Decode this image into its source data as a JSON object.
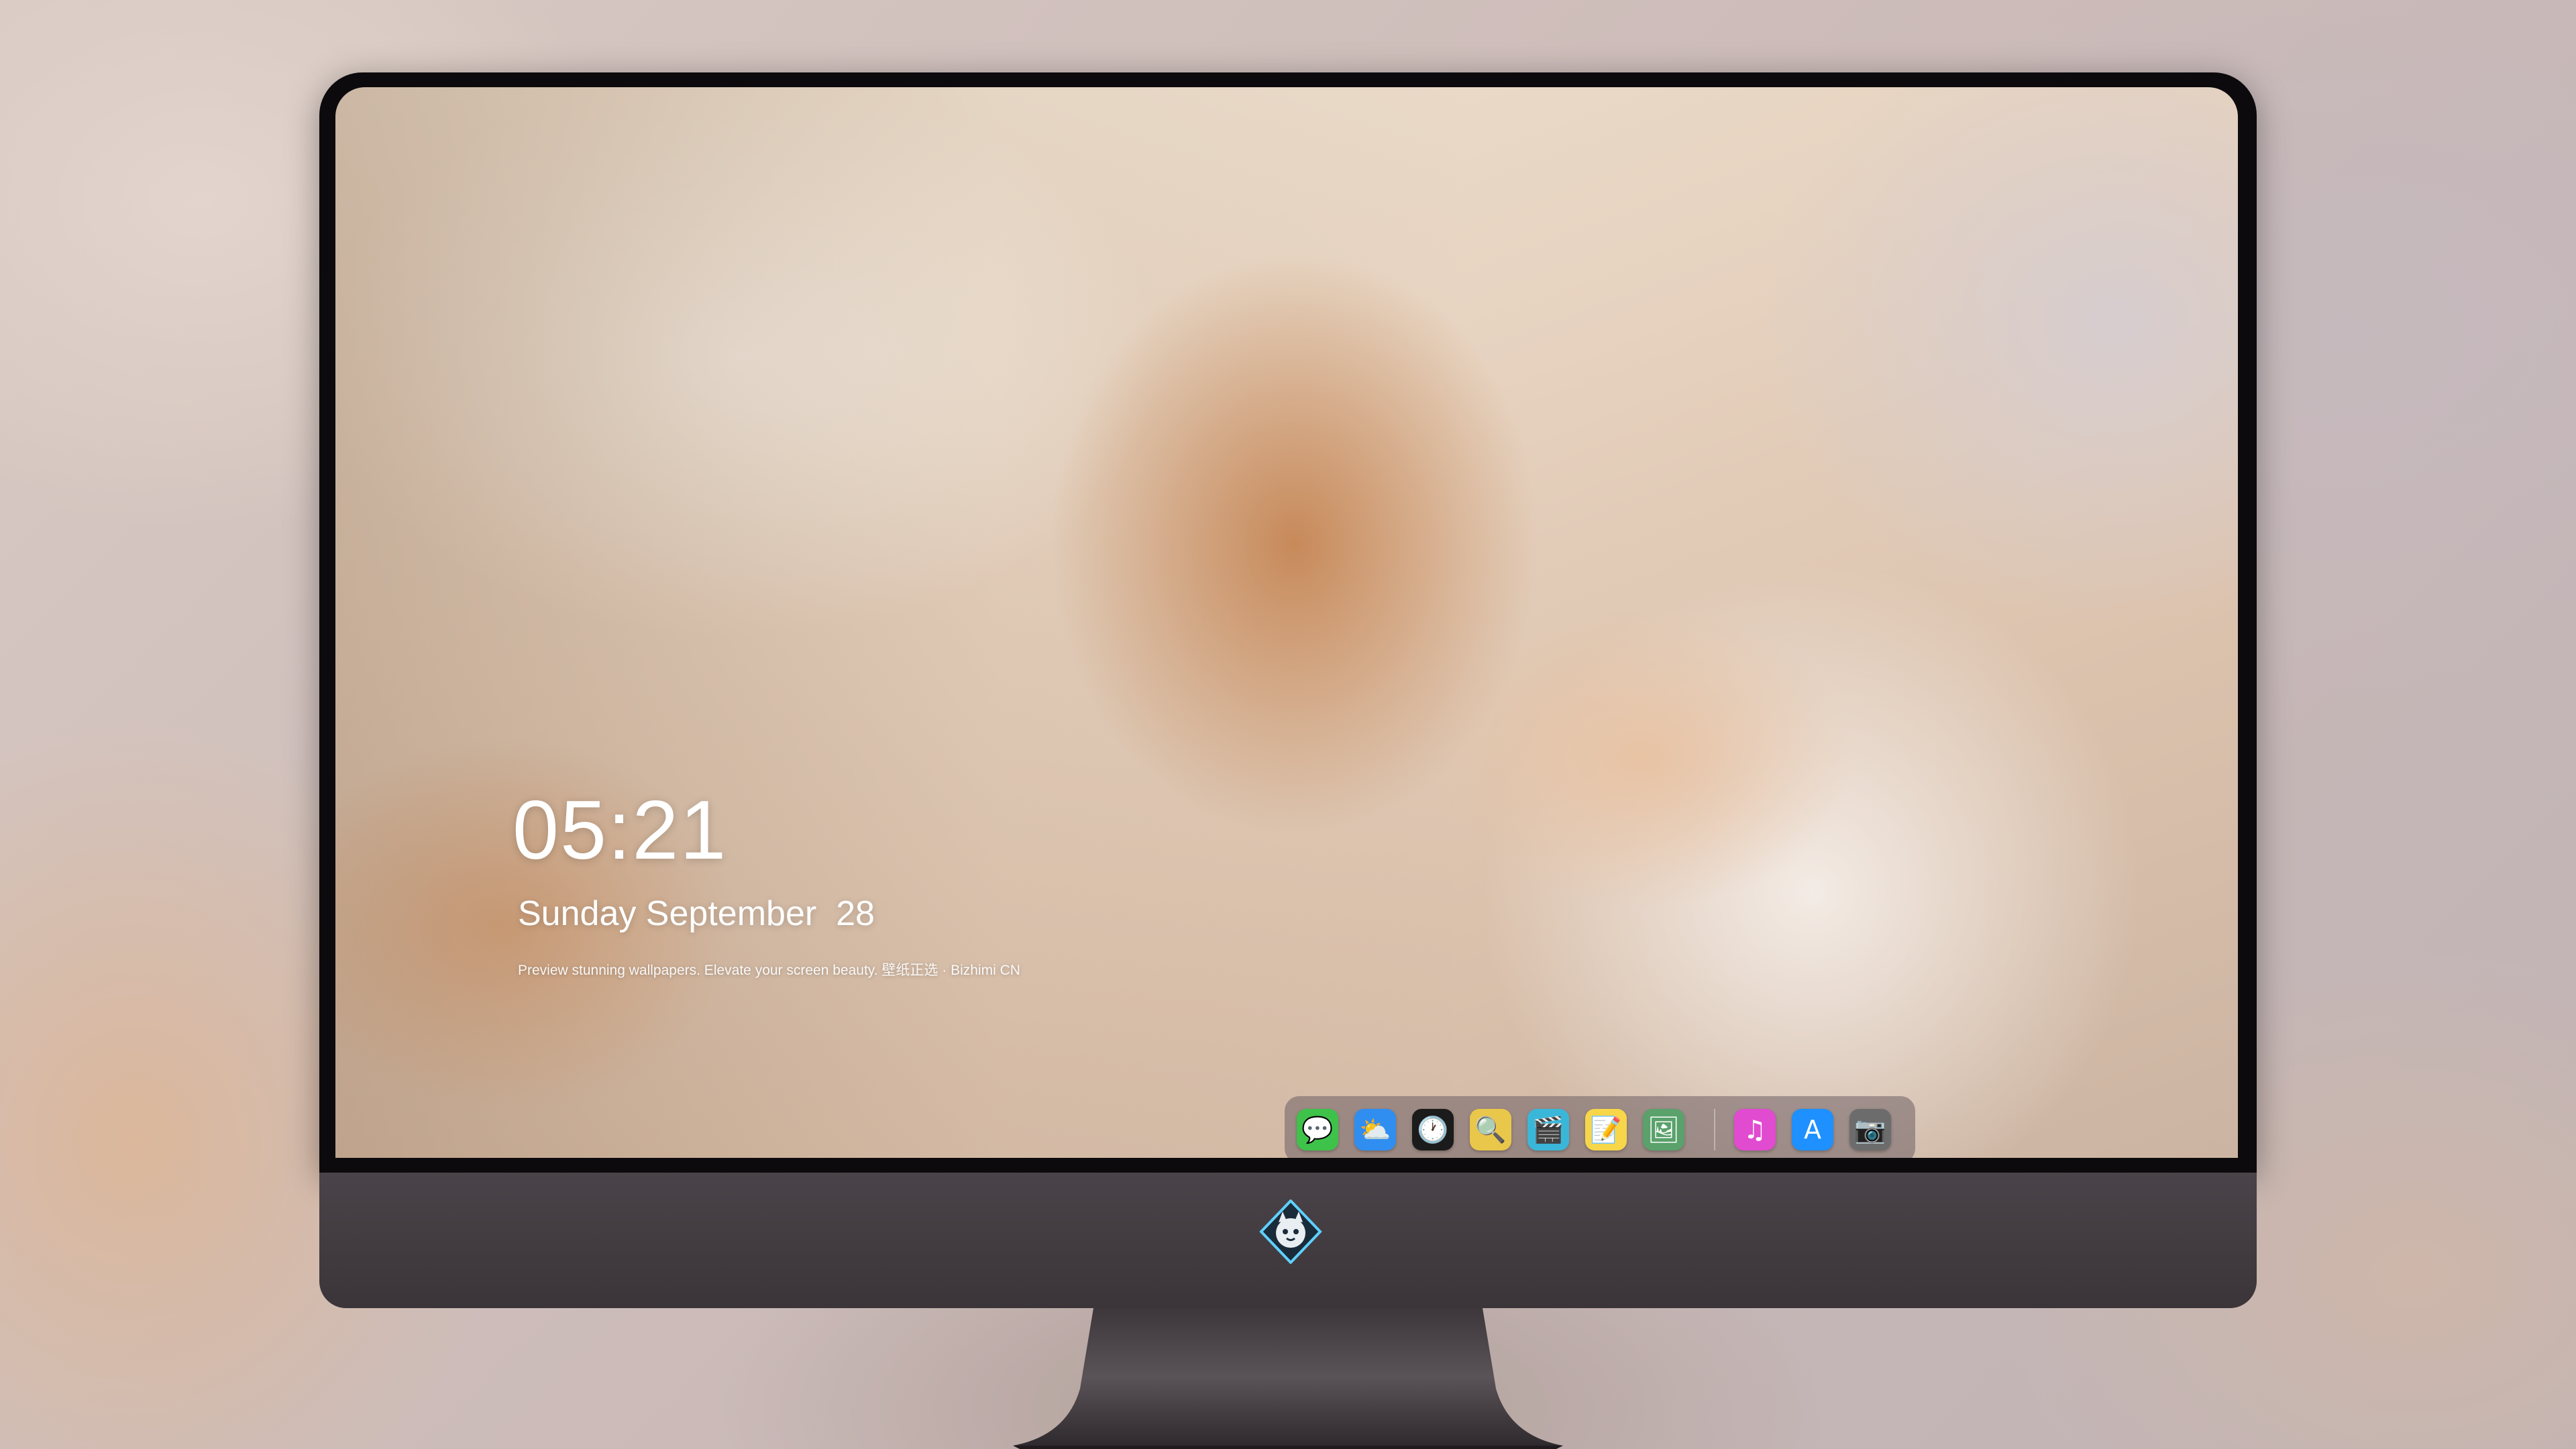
{
  "lock_screen": {
    "time": "05:21",
    "date": "Sunday September  28",
    "tagline": "Preview stunning wallpapers. Elevate your screen beauty. 壁纸正选 · Bizhimi CN"
  },
  "dock": {
    "apps": [
      {
        "name": "Messages",
        "icon": "messages-icon",
        "glyph": "💬",
        "color": "#3ec24a"
      },
      {
        "name": "Weather",
        "icon": "weather-icon",
        "glyph": "⛅",
        "color": "#2f8ef0"
      },
      {
        "name": "Clock",
        "icon": "clock-icon",
        "glyph": "🕐",
        "color": "#1b1b1b"
      },
      {
        "name": "Preview",
        "icon": "preview-icon",
        "glyph": "🔍",
        "color": "#e9c74a"
      },
      {
        "name": "Clips",
        "icon": "clapperboard-icon",
        "glyph": "🎬",
        "color": "#3ab7d8"
      },
      {
        "name": "Notes",
        "icon": "notes-icon",
        "glyph": "📝",
        "color": "#f7d64a"
      },
      {
        "name": "Photo Booth",
        "icon": "photos-icon",
        "glyph": "🖼",
        "color": "#5aa16b"
      },
      {
        "name": "Music",
        "icon": "music-icon",
        "glyph": "♫",
        "color": "#e14bd0"
      },
      {
        "name": "App Store",
        "icon": "app-store-icon",
        "glyph": "A",
        "color": "#1e90ff"
      },
      {
        "name": "Camera",
        "icon": "camera-icon",
        "glyph": "📷",
        "color": "#6c6c6c"
      }
    ]
  },
  "monitor": {
    "logo": "fox-mascot-logo-icon"
  }
}
